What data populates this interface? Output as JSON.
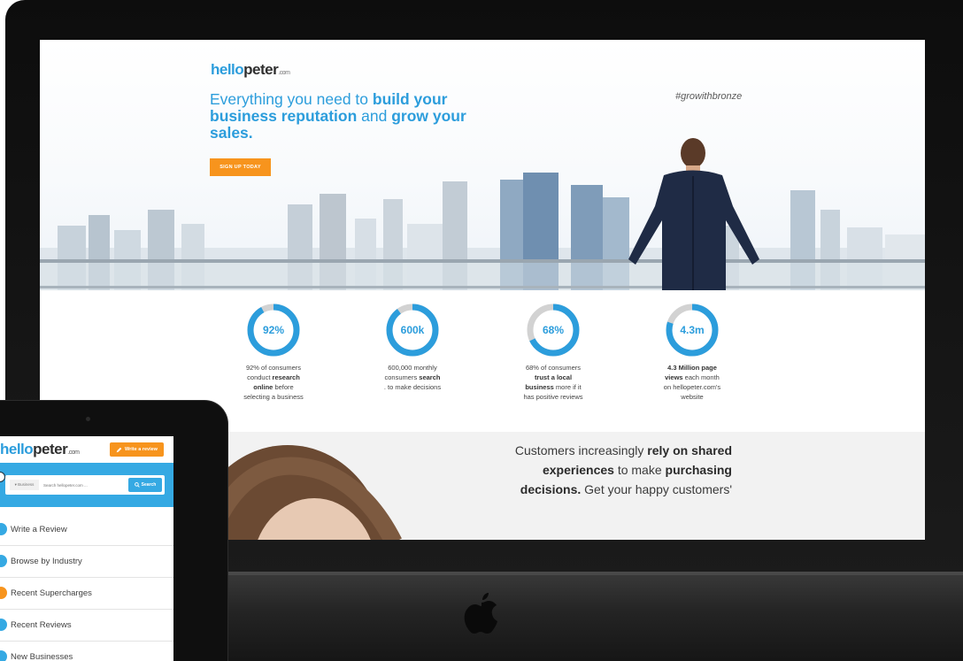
{
  "desktop_site": {
    "logo": {
      "main_a": "hello",
      "main_b": "peter",
      "suffix": ".com"
    },
    "headline": {
      "part1": "Everything you need to ",
      "part2": "build your business reputation",
      "part3": " and ",
      "part4": "grow your sales."
    },
    "hashtag": "#growithbronze",
    "signup_label": "SIGN UP TODAY",
    "stats": [
      {
        "value": "92%",
        "fraction": 0.92,
        "t1": "92% of consumers",
        "t2": "conduct ",
        "b2": "research",
        "b3": "online",
        "t3": " before",
        "t4": "selecting a business"
      },
      {
        "value": "600k",
        "fraction": 0.9,
        "t1": "600,000 monthly",
        "t2": "consumers ",
        "b2": "search",
        "t3": ". to make decisions"
      },
      {
        "value": "68%",
        "fraction": 0.68,
        "t1": "68% of consumers",
        "b2": "trust a local",
        "b3": "business",
        "t3": " more if it",
        "t4": "has positive reviews"
      },
      {
        "value": "4.3m",
        "fraction": 0.8,
        "b1": "4.3 Million page",
        "b2": "views",
        "t2": " each month",
        "t3": "on hellopeter.com's",
        "t4": "website"
      }
    ],
    "quote": {
      "p1": "Customers increasingly ",
      "b1": "rely on shared",
      "b2": "experiences",
      "p2": " to make ",
      "b3": "purchasing",
      "b4": "decisions.",
      "p3": " Get your happy customers'"
    }
  },
  "tablet_site": {
    "logo": {
      "main_a": "hello",
      "main_b": "peter",
      "suffix": ".com"
    },
    "write_review_label": "Write a review",
    "search": {
      "category": "▾ Business",
      "placeholder": "Search hellopeter.com ...",
      "button": "Search"
    },
    "menu": [
      {
        "label": "Write a Review",
        "color": "#35a9e3"
      },
      {
        "label": "Browse by Industry",
        "color": "#35a9e3"
      },
      {
        "label": "Recent Supercharges",
        "color": "#f7941d"
      },
      {
        "label": "Recent Reviews",
        "color": "#35a9e3"
      },
      {
        "label": "New Businesses",
        "color": "#35a9e3"
      }
    ]
  },
  "colors": {
    "brand_blue": "#2c9ddc",
    "accent_orange": "#f7941d",
    "ring_track": "#d2d2d2"
  },
  "icons": {
    "apple": "apple-logo-icon",
    "pencil": "pencil-icon",
    "search": "search-icon"
  }
}
